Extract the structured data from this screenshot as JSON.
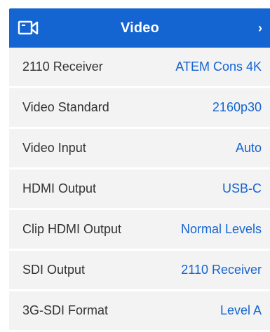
{
  "header": {
    "title": "Video",
    "icon": "video-camera-icon",
    "chevron": "›",
    "color": "#1464d2"
  },
  "rows": [
    {
      "label": "2110 Receiver",
      "value": "ATEM Cons 4K"
    },
    {
      "label": "Video Standard",
      "value": "2160p30"
    },
    {
      "label": "Video Input",
      "value": "Auto"
    },
    {
      "label": "HDMI Output",
      "value": "USB-C"
    },
    {
      "label": "Clip HDMI Output",
      "value": "Normal Levels"
    },
    {
      "label": "SDI Output",
      "value": "2110 Receiver"
    },
    {
      "label": "3G-SDI Format",
      "value": "Level A"
    }
  ]
}
